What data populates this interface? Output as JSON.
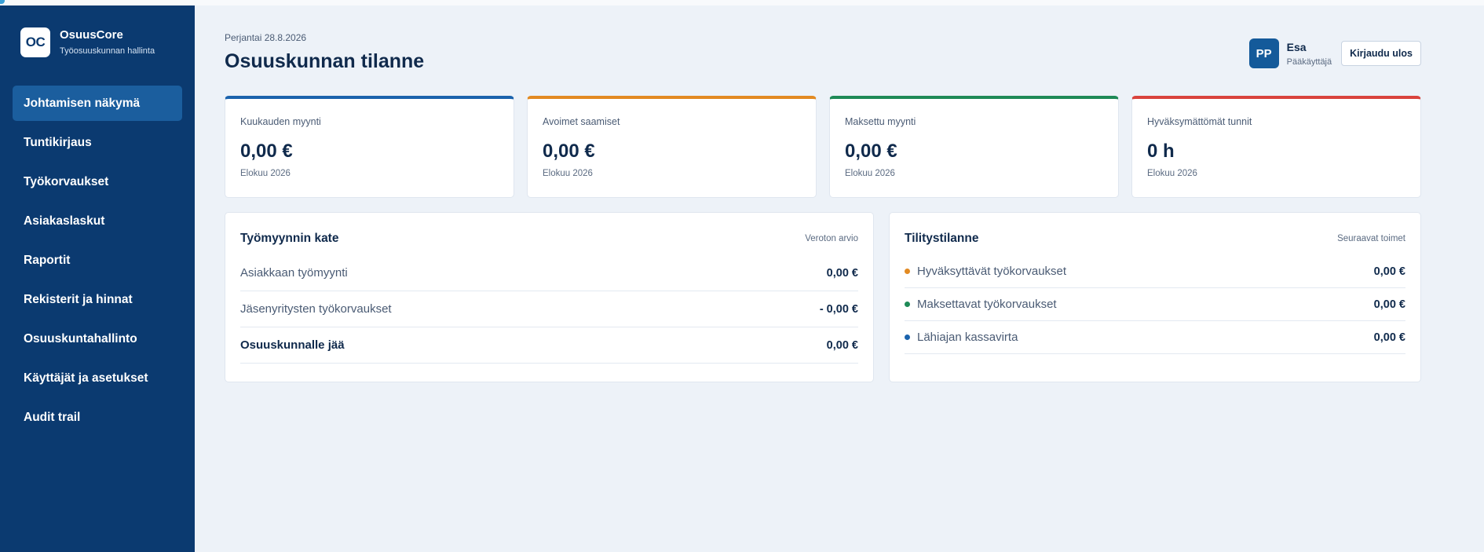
{
  "brand": {
    "logo": "OC",
    "name": "OsuusCore",
    "subtitle": "Työosuuskunnan hallinta"
  },
  "nav": {
    "items": [
      {
        "label": "Johtamisen näkymä",
        "active": true
      },
      {
        "label": "Tuntikirjaus",
        "active": false
      },
      {
        "label": "Työkorvaukset",
        "active": false
      },
      {
        "label": "Asiakaslaskut",
        "active": false
      },
      {
        "label": "Raportit",
        "active": false
      },
      {
        "label": "Rekisterit ja hinnat",
        "active": false
      },
      {
        "label": "Osuuskuntahallinto",
        "active": false
      },
      {
        "label": "Käyttäjät ja asetukset",
        "active": false
      },
      {
        "label": "Audit trail",
        "active": false
      }
    ]
  },
  "header": {
    "date": "Perjantai 28.8.2026",
    "title": "Osuuskunnan tilanne"
  },
  "user": {
    "initials": "PP",
    "name": "Esa",
    "role": "Pääkäyttäjä",
    "logout_label": "Kirjaudu ulos"
  },
  "stats": [
    {
      "label": "Kuukauden myynti",
      "value": "0,00 €",
      "period": "Elokuu 2026",
      "accent": "#1b63ad"
    },
    {
      "label": "Avoimet saamiset",
      "value": "0,00 €",
      "period": "Elokuu 2026",
      "accent": "#e28a22"
    },
    {
      "label": "Maksettu myynti",
      "value": "0,00 €",
      "period": "Elokuu 2026",
      "accent": "#1e8a57"
    },
    {
      "label": "Hyväksymättömät tunnit",
      "value": "0 h",
      "period": "Elokuu 2026",
      "accent": "#d9433d"
    }
  ],
  "margin_panel": {
    "title": "Työmyynnin kate",
    "note": "Veroton arvio",
    "rows": [
      {
        "label": "Asiakkaan työmyynti",
        "value": "0,00 €"
      },
      {
        "label": "Jäsenyritysten työkorvaukset",
        "value": "- 0,00 €"
      },
      {
        "label": "Osuuskunnalle jää",
        "value": "0,00 €"
      }
    ]
  },
  "settlement_panel": {
    "title": "Tilitystilanne",
    "note": "Seuraavat toimet",
    "rows": [
      {
        "label": "Hyväksyttävät työkorvaukset",
        "value": "0,00 €",
        "color": "#e28a22"
      },
      {
        "label": "Maksettavat työkorvaukset",
        "value": "0,00 €",
        "color": "#1e8a57"
      },
      {
        "label": "Lähiajan kassavirta",
        "value": "0,00 €",
        "color": "#1b63ad"
      }
    ]
  }
}
